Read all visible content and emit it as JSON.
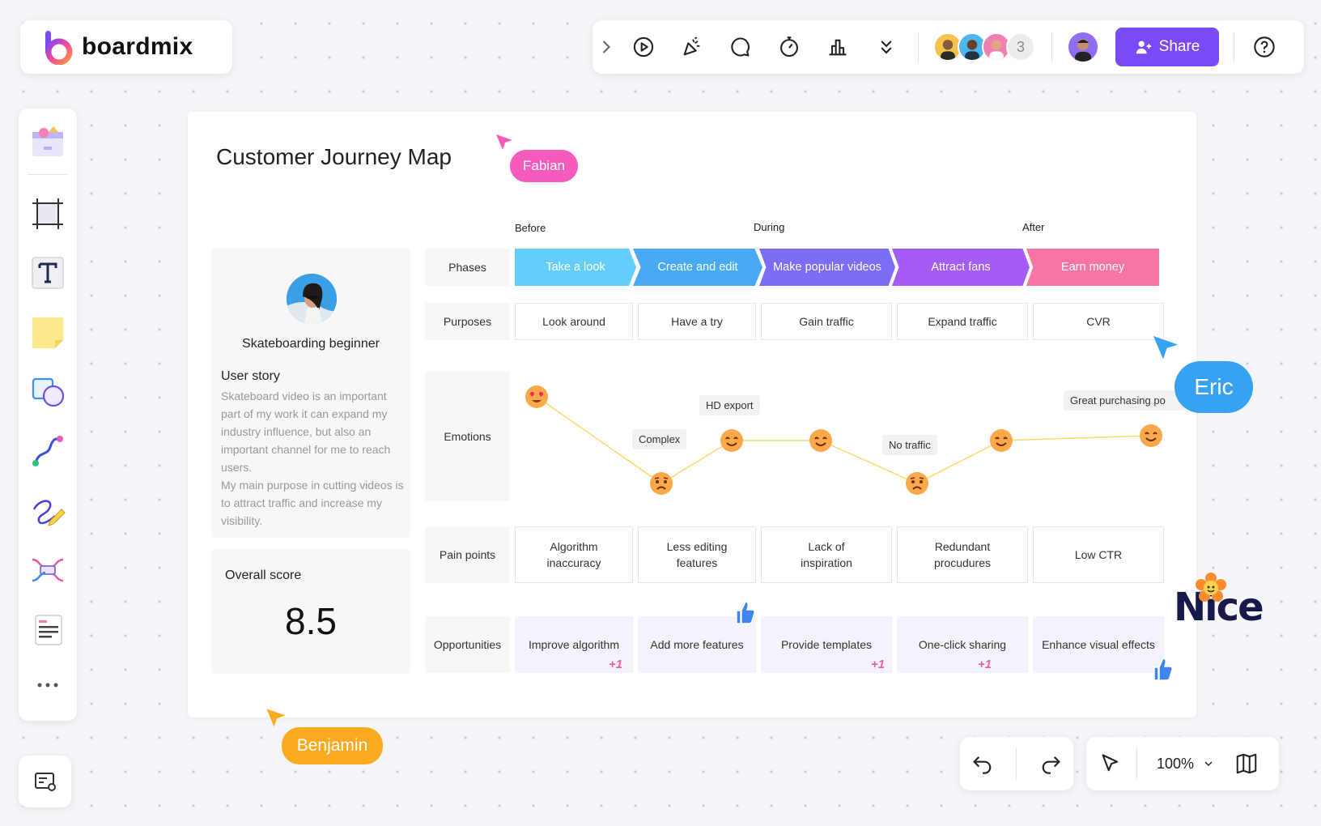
{
  "app": {
    "logo_text": "boardmix"
  },
  "toolbar": {
    "collaborator_count": "3",
    "share_label": "Share",
    "icons": [
      "chevron-right-icon",
      "play-icon",
      "celebrate-icon",
      "comment-icon",
      "timer-icon",
      "vote-icon",
      "more-down-icon",
      "help-icon"
    ]
  },
  "board": {
    "title": "Customer Journey Map",
    "stage_headers": [
      "Before",
      "During",
      "After"
    ],
    "row_labels": {
      "phases": "Phases",
      "purposes": "Purposes",
      "emotions": "Emotions",
      "pain": "Pain points",
      "opps": "Opportunities"
    },
    "phases": [
      {
        "label": "Take a look",
        "color": "#63cdfb"
      },
      {
        "label": "Create and edit",
        "color": "#48aaf5"
      },
      {
        "label": "Make popular videos",
        "color": "#7b6df6"
      },
      {
        "label": "Attract fans",
        "color": "#a55cf4"
      },
      {
        "label": "Earn money",
        "color": "#f674a6"
      }
    ],
    "purposes": [
      "Look around",
      "Have a try",
      "Gain traffic",
      "Expand traffic",
      "CVR"
    ],
    "emotion_tags": [
      "Complex",
      "HD export",
      "No traffic",
      "Great purchasing po"
    ],
    "pain_points": [
      "Algorithm\ninaccuracy",
      "Less editing\nfeatures",
      "Lack of\ninspiration",
      "Redundant\nprocudures",
      "Low CTR"
    ],
    "opportunities": [
      "Improve algorithm",
      "Add more features",
      "Provide templates",
      "One-click sharing",
      "Enhance visual effects"
    ],
    "plus_one": "+1",
    "persona": {
      "name": "Skateboarding beginner",
      "section": "User story",
      "story": "Skateboard video is an important part of my work it can expand my industry influence, but also an important channel for me to reach users.\nMy main purpose in cutting videos is to attract traffic and increase my visibility."
    },
    "score": {
      "label": "Overall score",
      "value": "8.5"
    }
  },
  "cursors": [
    {
      "name": "Fabian",
      "color": "#f55bbd"
    },
    {
      "name": "Eric",
      "color": "#35a2f4"
    },
    {
      "name": "Benjamin",
      "color": "#fba91f"
    }
  ],
  "sticker_text": "Nice",
  "zoom": "100%"
}
